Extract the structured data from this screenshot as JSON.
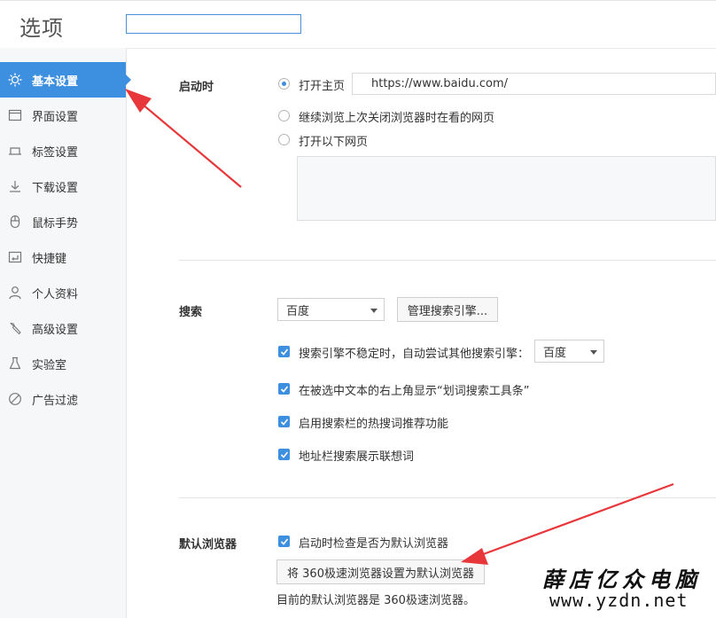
{
  "app": {
    "title": "选项",
    "search_value": ""
  },
  "sidebar": {
    "items": [
      {
        "label": "基本设置",
        "icon": "gear-icon",
        "active": true
      },
      {
        "label": "界面设置",
        "icon": "window-icon"
      },
      {
        "label": "标签设置",
        "icon": "tab-icon"
      },
      {
        "label": "下载设置",
        "icon": "download-icon"
      },
      {
        "label": "鼠标手势",
        "icon": "mouse-icon"
      },
      {
        "label": "快捷键",
        "icon": "keyboard-icon"
      },
      {
        "label": "个人资料",
        "icon": "user-icon"
      },
      {
        "label": "高级设置",
        "icon": "wrench-icon"
      },
      {
        "label": "实验室",
        "icon": "flask-icon"
      },
      {
        "label": "广告过滤",
        "icon": "block-icon"
      }
    ]
  },
  "startup": {
    "label": "启动时",
    "opt_home": "打开主页",
    "home_url": "https://www.baidu.com/",
    "opt_continue": "继续浏览上次关闭浏览器时在看的网页",
    "opt_pages": "打开以下网页"
  },
  "search": {
    "label": "搜索",
    "engine": "百度",
    "manage_button": "管理搜索引擎...",
    "fallback_label": "搜索引擎不稳定时，自动尝试其他搜索引擎：",
    "fallback_engine": "百度",
    "cb_toolbar": "在被选中文本的右上角显示“划词搜索工具条”",
    "cb_hotwords": "启用搜索栏的热搜词推荐功能",
    "cb_suggest": "地址栏搜索展示联想词"
  },
  "default_browser": {
    "label": "默认浏览器",
    "cb_check": "启动时检查是否为默认浏览器",
    "set_button": "将 360极速浏览器设置为默认浏览器",
    "status": "目前的默认浏览器是 360极速浏览器。"
  },
  "watermark": {
    "cn": "薛店亿众电脑",
    "url": "www.yzdn.net"
  },
  "colors": {
    "accent": "#3d8fe0",
    "arrow": "#e8373a"
  }
}
